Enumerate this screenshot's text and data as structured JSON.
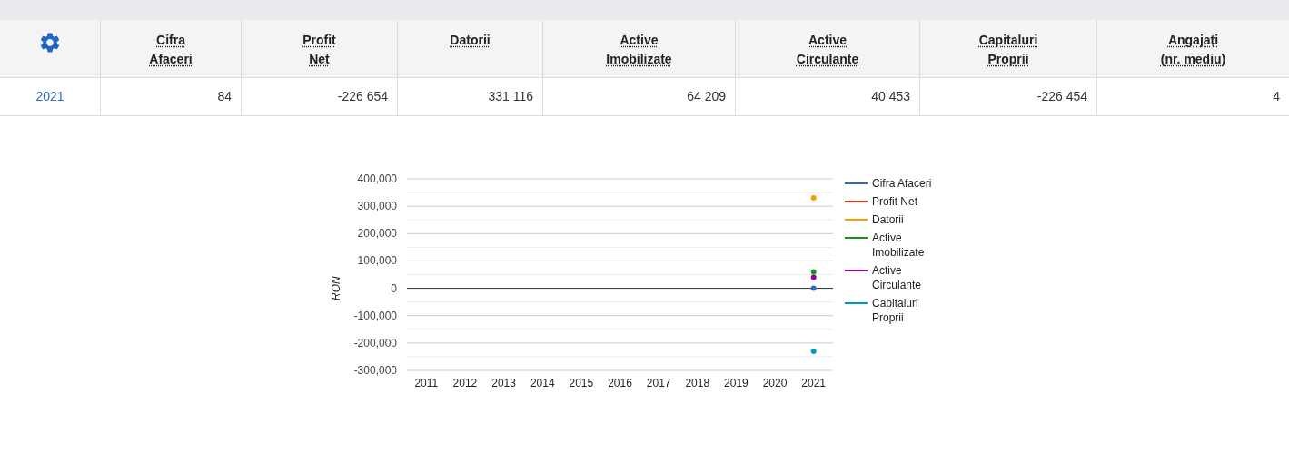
{
  "table": {
    "columns": [
      {
        "kind": "icon"
      },
      {
        "kind": "text",
        "lines": [
          "Cifra",
          "Afaceri"
        ]
      },
      {
        "kind": "text",
        "lines": [
          "Profit",
          "Net"
        ]
      },
      {
        "kind": "text",
        "lines": [
          "Datorii"
        ]
      },
      {
        "kind": "text",
        "lines": [
          "Active",
          "Imobilizate"
        ]
      },
      {
        "kind": "text",
        "lines": [
          "Active",
          "Circulante"
        ]
      },
      {
        "kind": "text",
        "lines": [
          "Capitaluri",
          "Proprii"
        ]
      },
      {
        "kind": "text",
        "lines": [
          "Angajați",
          "(nr. mediu)"
        ]
      }
    ],
    "rows": [
      {
        "year": "2021",
        "cells": [
          "84",
          "-226 654",
          "331 116",
          "64 209",
          "40 453",
          "-226 454",
          "4"
        ]
      }
    ]
  },
  "chart": {
    "chart_data": {
      "type": "line",
      "ylabel": "RON",
      "x": [
        "2011",
        "2012",
        "2013",
        "2014",
        "2015",
        "2016",
        "2017",
        "2018",
        "2019",
        "2020",
        "2021"
      ],
      "ylim": [
        -300000,
        400000
      ],
      "grid": true,
      "legend": "right",
      "yticks": [
        {
          "value": 400000,
          "label": "400,000"
        },
        {
          "value": 300000,
          "label": "300,000"
        },
        {
          "value": 200000,
          "label": "200,000"
        },
        {
          "value": 100000,
          "label": "100,000"
        },
        {
          "value": 0,
          "label": "0"
        },
        {
          "value": -100000,
          "label": "-100,000"
        },
        {
          "value": -200000,
          "label": "-200,000"
        },
        {
          "value": -300000,
          "label": "-300,000"
        }
      ],
      "series": [
        {
          "name": "Cifra Afaceri",
          "color": "#3366cc",
          "marker": true,
          "values": [
            null,
            null,
            null,
            null,
            null,
            null,
            null,
            null,
            null,
            null,
            0
          ]
        },
        {
          "name": "Profit Net",
          "color": "#dc3912",
          "values": [
            null,
            null,
            null,
            null,
            null,
            null,
            null,
            null,
            null,
            null,
            null
          ]
        },
        {
          "name": "Datorii",
          "color": "#ff9900",
          "marker": true,
          "values": [
            null,
            null,
            null,
            null,
            null,
            null,
            null,
            null,
            null,
            null,
            330000
          ]
        },
        {
          "name": "Active Imobilizate",
          "color": "#109618",
          "marker": true,
          "values": [
            null,
            null,
            null,
            null,
            null,
            null,
            null,
            null,
            null,
            null,
            60000
          ]
        },
        {
          "name": "Active Circulante",
          "color": "#990099",
          "marker": true,
          "values": [
            null,
            null,
            null,
            null,
            null,
            null,
            null,
            null,
            null,
            null,
            40000
          ]
        },
        {
          "name": "Capitaluri Proprii",
          "color": "#0099c6",
          "marker": true,
          "values": [
            null,
            null,
            null,
            null,
            null,
            null,
            null,
            null,
            null,
            null,
            -230000
          ]
        }
      ]
    }
  }
}
